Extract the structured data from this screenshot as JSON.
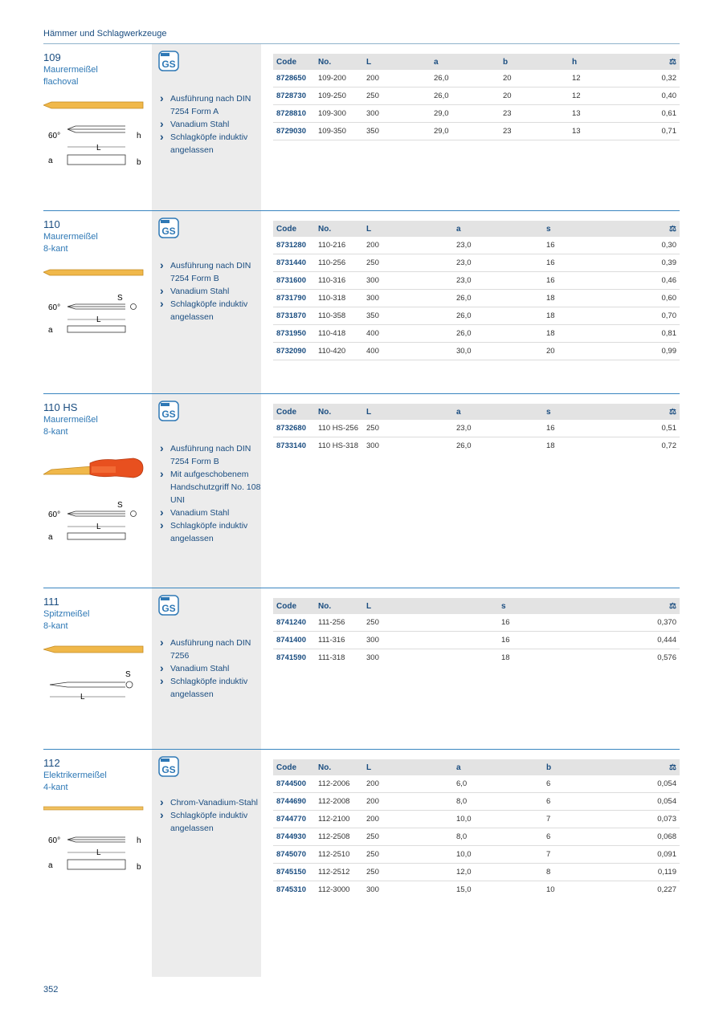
{
  "header": {
    "title": "Hämmer und Schlagwerkzeuge"
  },
  "page_number": "352",
  "weight_icon_name": "scale-kg-icon",
  "sections": [
    {
      "number": "109",
      "name_lines": [
        "Maurermeißel",
        "flachoval"
      ],
      "features": [
        "Ausführung nach DIN 7254 Form A",
        "Vanadium Stahl",
        "Schlagköpfe induktiv angelassen"
      ],
      "columns": [
        "Code",
        "No.",
        "L",
        "a",
        "b",
        "h",
        ""
      ],
      "rows": [
        [
          "8728650",
          "109-200",
          "200",
          "26,0",
          "20",
          "12",
          "0,32"
        ],
        [
          "8728730",
          "109-250",
          "250",
          "26,0",
          "20",
          "12",
          "0,40"
        ],
        [
          "8728810",
          "109-300",
          "300",
          "29,0",
          "23",
          "13",
          "0,61"
        ],
        [
          "8729030",
          "109-350",
          "350",
          "29,0",
          "23",
          "13",
          "0,71"
        ]
      ],
      "diagram_labels": {
        "angle": "60°",
        "h": "h",
        "L": "L",
        "a": "a",
        "b": "b"
      }
    },
    {
      "number": "110",
      "name_lines": [
        "Maurermeißel",
        "8-kant"
      ],
      "features": [
        "Ausführung nach DIN 7254 Form B",
        "Vanadium Stahl",
        "Schlagköpfe induktiv angelassen"
      ],
      "columns": [
        "Code",
        "No.",
        "L",
        "a",
        "s",
        ""
      ],
      "rows": [
        [
          "8731280",
          "110-216",
          "200",
          "23,0",
          "16",
          "0,30"
        ],
        [
          "8731440",
          "110-256",
          "250",
          "23,0",
          "16",
          "0,39"
        ],
        [
          "8731600",
          "110-316",
          "300",
          "23,0",
          "16",
          "0,46"
        ],
        [
          "8731790",
          "110-318",
          "300",
          "26,0",
          "18",
          "0,60"
        ],
        [
          "8731870",
          "110-358",
          "350",
          "26,0",
          "18",
          "0,70"
        ],
        [
          "8731950",
          "110-418",
          "400",
          "26,0",
          "18",
          "0,81"
        ],
        [
          "8732090",
          "110-420",
          "400",
          "30,0",
          "20",
          "0,99"
        ]
      ],
      "diagram_labels": {
        "angle": "60°",
        "S": "S",
        "L": "L",
        "a": "a"
      }
    },
    {
      "number": "110 HS",
      "name_lines": [
        "Maurermeißel",
        "8-kant"
      ],
      "features": [
        "Ausführung nach DIN 7254 Form B",
        "Mit aufgeschobenem Handschutzgriff No. 108 UNI",
        "Vanadium Stahl",
        "Schlagköpfe induktiv angelassen"
      ],
      "columns": [
        "Code",
        "No.",
        "L",
        "a",
        "s",
        ""
      ],
      "rows": [
        [
          "8732680",
          "110 HS-256",
          "250",
          "23,0",
          "16",
          "0,51"
        ],
        [
          "8733140",
          "110 HS-318",
          "300",
          "26,0",
          "18",
          "0,72"
        ]
      ],
      "diagram_labels": {
        "angle": "60°",
        "S": "S",
        "L": "L",
        "a": "a"
      }
    },
    {
      "number": "111",
      "name_lines": [
        "Spitzmeißel",
        "8-kant"
      ],
      "features": [
        "Ausführung nach DIN 7256",
        "Vanadium Stahl",
        "Schlagköpfe induktiv angelassen"
      ],
      "columns": [
        "Code",
        "No.",
        "L",
        "s",
        ""
      ],
      "rows": [
        [
          "8741240",
          "111-256",
          "250",
          "16",
          "0,370"
        ],
        [
          "8741400",
          "111-316",
          "300",
          "16",
          "0,444"
        ],
        [
          "8741590",
          "111-318",
          "300",
          "18",
          "0,576"
        ]
      ],
      "diagram_labels": {
        "S": "S",
        "L": "L"
      }
    },
    {
      "number": "112",
      "name_lines": [
        "Elektrikermeißel",
        "4-kant"
      ],
      "features": [
        "Chrom-Vanadium-Stahl",
        "Schlagköpfe induktiv angelassen"
      ],
      "columns": [
        "Code",
        "No.",
        "L",
        "a",
        "b",
        ""
      ],
      "rows": [
        [
          "8744500",
          "112-2006",
          "200",
          "6,0",
          "6",
          "0,054"
        ],
        [
          "8744690",
          "112-2008",
          "200",
          "8,0",
          "6",
          "0,054"
        ],
        [
          "8744770",
          "112-2100",
          "200",
          "10,0",
          "7",
          "0,073"
        ],
        [
          "8744930",
          "112-2508",
          "250",
          "8,0",
          "6",
          "0,068"
        ],
        [
          "8745070",
          "112-2510",
          "250",
          "10,0",
          "7",
          "0,091"
        ],
        [
          "8745150",
          "112-2512",
          "250",
          "12,0",
          "8",
          "0,119"
        ],
        [
          "8745310",
          "112-3000",
          "300",
          "15,0",
          "10",
          "0,227"
        ]
      ],
      "diagram_labels": {
        "angle": "60°",
        "h": "h",
        "L": "L",
        "a": "a",
        "b": "b"
      }
    }
  ]
}
